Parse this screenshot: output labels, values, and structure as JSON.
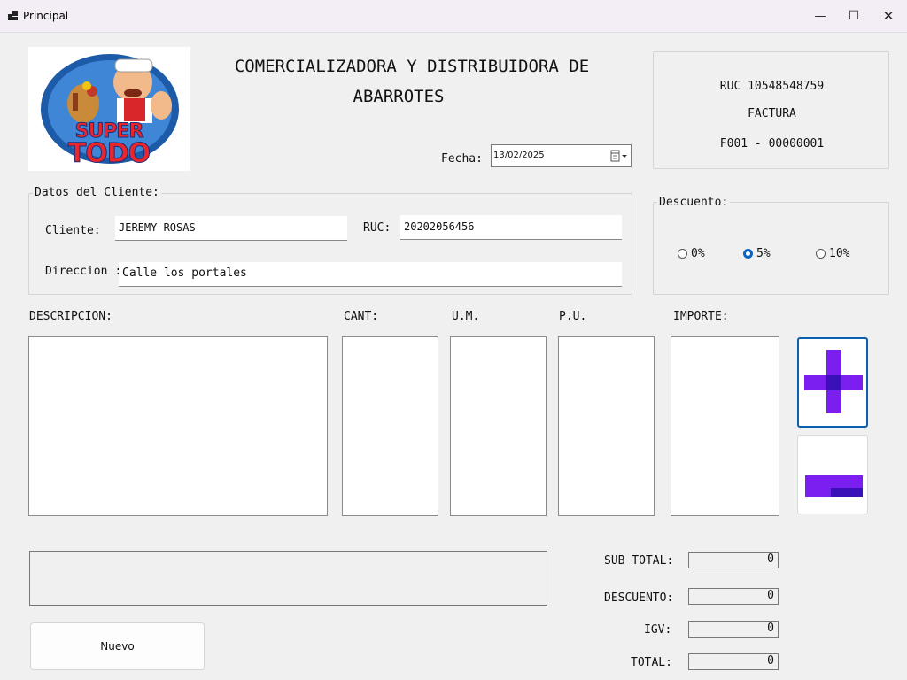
{
  "window": {
    "title": "Principal",
    "minimize_label": "—",
    "maximize_label": "☐",
    "close_label": "✕"
  },
  "logo": {
    "line1": "SUPER",
    "line2": "TODO"
  },
  "header": {
    "company_line1": "COMERCIALIZADORA Y DISTRIBUIDORA DE",
    "company_line2": "ABARROTES"
  },
  "invoice_box": {
    "ruc": "RUC 10548548759",
    "doc_type": "FACTURA",
    "number": "F001 - 00000001"
  },
  "date": {
    "label": "Fecha:",
    "value": "13/02/2025"
  },
  "client": {
    "group_label": "Datos del Cliente:",
    "name_label": "Cliente:",
    "name_value": "JEREMY ROSAS",
    "ruc_label": "RUC:",
    "ruc_value": "20202056456",
    "address_label": "Direccion",
    "address_suffix": ":",
    "address_value": "Calle los portales"
  },
  "discount": {
    "group_label": "Descuento:",
    "options": [
      {
        "label": "0%",
        "selected": false
      },
      {
        "label": "5%",
        "selected": true
      },
      {
        "label": "10%",
        "selected": false
      }
    ]
  },
  "columns": {
    "descripcion": "DESCRIPCION:",
    "cant": "CANT:",
    "um": "U.M.",
    "pu": "P.U.",
    "importe": "IMPORTE:"
  },
  "totals": {
    "subtotal_label": "SUB TOTAL:",
    "subtotal_value": "0",
    "descuento_label": "DESCUENTO:",
    "descuento_value": "0",
    "igv_label": "IGV:",
    "igv_value": "0",
    "total_label": "TOTAL:",
    "total_value": "0"
  },
  "buttons": {
    "nuevo_label": "Nuevo",
    "add_icon": "plus-icon",
    "remove_icon": "minus-icon"
  },
  "colors": {
    "accent_purple": "#7a1ff0",
    "dark_purple": "#3a10b8",
    "radio_blue": "#0a63c9"
  }
}
